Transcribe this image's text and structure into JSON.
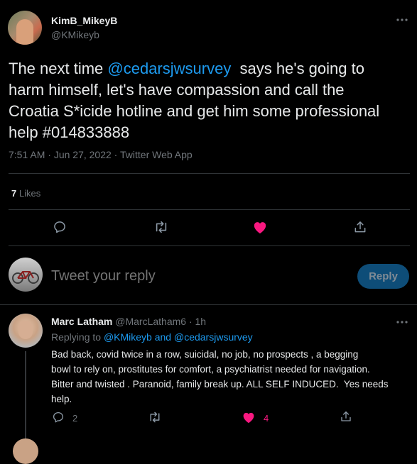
{
  "tweet": {
    "author_name": "KimB_MikeyB",
    "author_handle": "@KMikeyb",
    "text_before": "The next time ",
    "mention": "@cedarsjwsurvey",
    "text_line1_rest": "  says he's going to",
    "text_line2": "harm himself, let's have compassion and call the",
    "text_line3": "Croatia S*icide hotline and get him some professional",
    "text_line4": "help #014833888",
    "time": "7:51 AM",
    "date": "Jun 27, 2022",
    "source": "Twitter Web App",
    "likes_count": "7",
    "likes_label": "Likes",
    "liked": true
  },
  "reply_box": {
    "placeholder": "Tweet your reply",
    "button_label": "Reply"
  },
  "reply": {
    "author_name": "Marc Latham",
    "author_handle": "@MarcLatham6",
    "age": "1h",
    "replying_to_label": "Replying to",
    "replying_to_user1": "@KMikeyb",
    "replying_and": "and",
    "replying_to_user2": "@cedarsjwsurvey",
    "line1": "Bad back, covid twice in a row, suicidal, no job, no prospects , a begging",
    "line2": "bowl to rely on, prostitutes for comfort, a psychiatrist needed for navigation.",
    "line3": "Bitter and twisted . Paranoid, family break up. ALL SELF INDUCED.  Yes needs",
    "line4": "help.",
    "reply_count": "2",
    "like_count": "4"
  },
  "colors": {
    "background": "#000000",
    "accent": "#1d9bf0",
    "like": "#f91880",
    "muted": "#71767b",
    "divider": "#2f3336"
  },
  "icons": [
    "more-icon",
    "reply-icon",
    "retweet-icon",
    "heart-filled-icon",
    "share-icon"
  ]
}
